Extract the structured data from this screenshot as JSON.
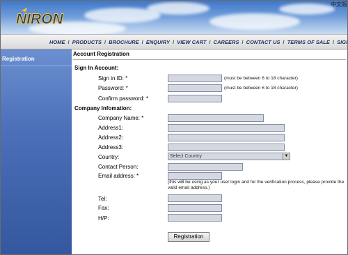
{
  "header": {
    "brand": "NIRON",
    "lang_link": "中文版"
  },
  "nav": {
    "items": [
      "HOME",
      "PRODUCTS",
      "BROCHURE",
      "ENQUIRY",
      "VIEW CART",
      "CAREERS",
      "CONTACT US",
      "TERMS OF SALE",
      "SIGN IN"
    ]
  },
  "sidebar": {
    "items": [
      {
        "label": "Registration"
      }
    ]
  },
  "main": {
    "title": "Account Registration",
    "sections": {
      "sign_in": "Sign In Account:",
      "company": "Company Infomation:"
    },
    "fields": {
      "sign_in_id": {
        "label": "Sign in ID: *",
        "value": "",
        "note": "(must be between 6 to 18 character)"
      },
      "password": {
        "label": "Password: *",
        "value": "",
        "note": "(must be between 6 to 18 character)"
      },
      "confirm_password": {
        "label": "Confirm password: *",
        "value": ""
      },
      "company_name": {
        "label": "Company Name: *",
        "value": ""
      },
      "address1": {
        "label": "Address1:",
        "value": ""
      },
      "address2": {
        "label": "Address2:",
        "value": ""
      },
      "address3": {
        "label": "Address3:",
        "value": ""
      },
      "country": {
        "label": "Country:",
        "value": "Select Country"
      },
      "contact_person": {
        "label": "Contact Person:",
        "value": ""
      },
      "email": {
        "label": "Email address: *",
        "value": "",
        "note": "(this will be using as your user login and for the verification process, please provide the valid email address.)"
      },
      "tel": {
        "label": "Tel:",
        "value": ""
      },
      "fax": {
        "label": "Fax:",
        "value": ""
      },
      "hp": {
        "label": "H/P:",
        "value": ""
      }
    },
    "submit_label": "Registration"
  },
  "colors": {
    "sidebar": "#4b6fb8",
    "nav_text": "#1c2a5a",
    "field_bg": "#d6d8e0"
  }
}
